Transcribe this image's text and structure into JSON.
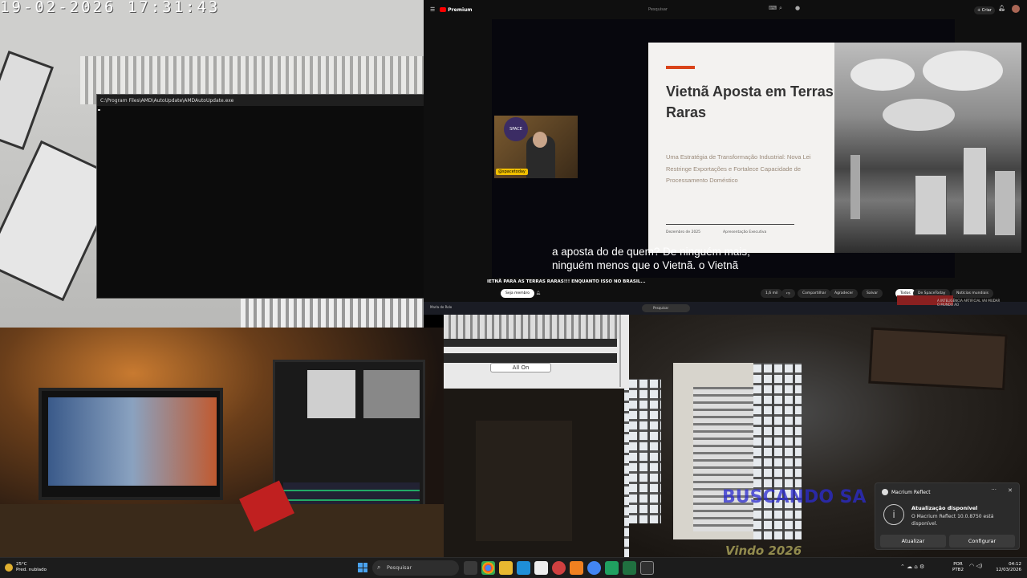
{
  "camera_top_left": {
    "timestamp": "19-02-2026  17:31:43"
  },
  "console_window": {
    "title": "C:\\Program Files\\AMD\\AutoUpdate\\AMDAutoUpdate.exe",
    "minimize": "–",
    "maximize": "□",
    "close": "✕"
  },
  "youtube": {
    "logo_text": "Premium",
    "search_placeholder": "Pesquisar",
    "create_label": "+ Criar",
    "slide": {
      "title": "Vietnã Aposta em Terras Raras",
      "subtitle": "Uma Estratégia de Transformação Industrial: Nova Lei Restringe Exportações e Fortalece Capacidade de Processamento Doméstico",
      "date": "Dezembro de 2025",
      "presenter": "Apresentação Executiva"
    },
    "webcam_badge": "@spacetoday",
    "webcam_logo": "SPACE",
    "subtitles_line1": "a aposta do de quem? De ninguém mais,",
    "subtitles_line2": "ninguém menos que o Vietnã. o Vietnã",
    "ticker": "IETNÃ PARA AS TERRAS RARAS!!! ENQUANTO ISSO NO BRASIL...",
    "subscribe_label": "Seja membro",
    "likes": "1,6 mil",
    "share": "Compartilhar",
    "thanks": "Agradecer",
    "save": "Salvar",
    "chip_all": "Todos",
    "chip_channel": "De SpaceToday",
    "chip_news": "Notícias mundiais",
    "side_title": "A INTELIGÊNCIA ARTIFICIAL VAI MUDAR O MUNDO AO"
  },
  "remote_taskbar": {
    "search": "Pesquisar",
    "user": "Marla de Rolo"
  },
  "all_on_window": {
    "button": "All On"
  },
  "graffiti": {
    "text1": "BUSCANDO SA",
    "text2": "Vindo 2026"
  },
  "notification": {
    "app": "Macrium Reflect",
    "title": "Atualização disponível",
    "body": "O Macrium Reflect 10.0.8750 está disponível.",
    "btn_update": "Atualizar",
    "btn_config": "Configurar",
    "more": "···",
    "close": "✕"
  },
  "taskbar": {
    "temp": "25°C",
    "weather": "Pred. nublado",
    "search": "Pesquisar",
    "lang1": "POR",
    "lang2": "PTB2",
    "time": "04:12",
    "date": "12/03/2026"
  },
  "colors": {
    "yt_red": "#ff0000",
    "slide_accent": "#d9441a",
    "graffiti_blue": "#2b2bd0"
  }
}
